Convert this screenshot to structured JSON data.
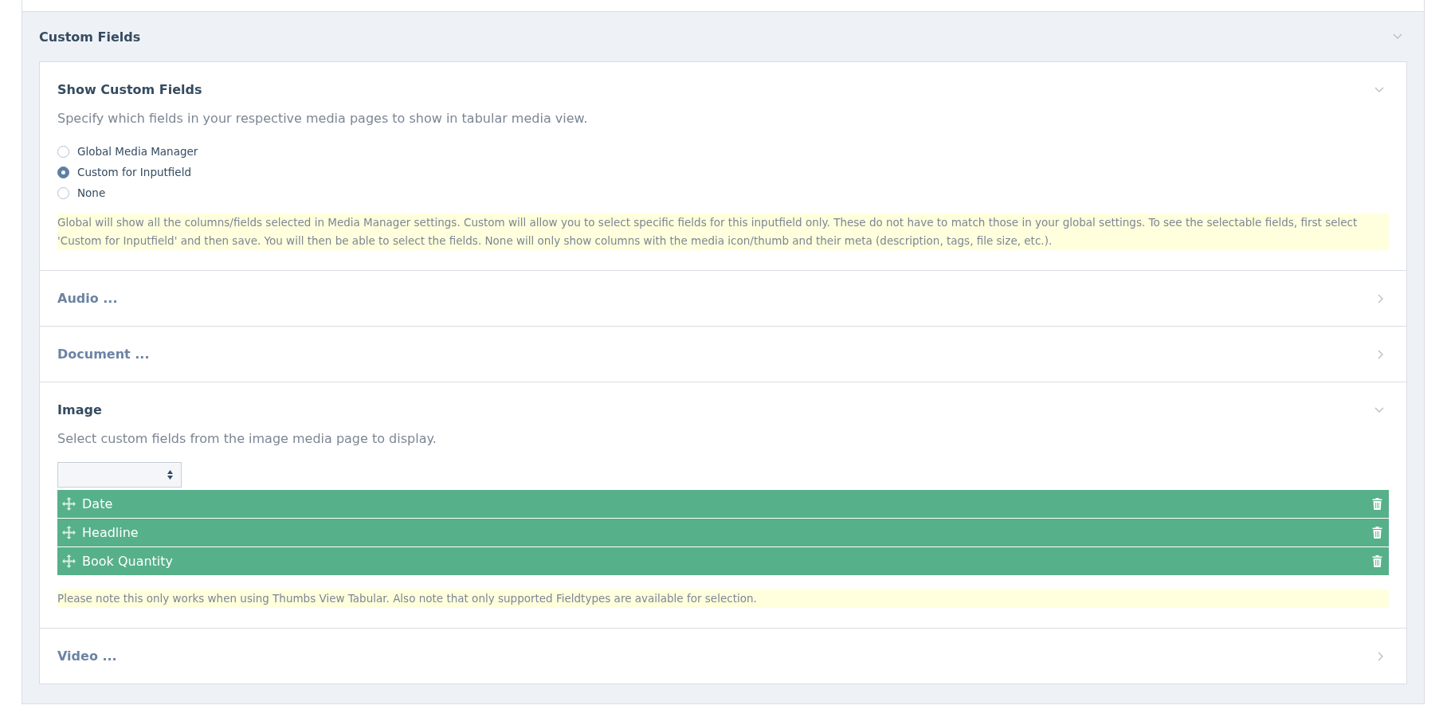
{
  "panel": {
    "title": "Custom Fields",
    "expanded": true
  },
  "sections": [
    {
      "kind": "radios",
      "title": "Show Custom Fields",
      "expanded": true,
      "description": "Specify which fields in your respective media pages to show in tabular media view.",
      "options": [
        {
          "label": "Global Media Manager",
          "selected": false
        },
        {
          "label": "Custom for Inputfield",
          "selected": true
        },
        {
          "label": "None",
          "selected": false
        }
      ],
      "note": "Global will show all the columns/fields selected in Media Manager settings. Custom will allow you to select specific fields for this inputfield only. These do not have to match those in your global settings. To see the selectable fields, first select 'Custom for Inputfield' and then save. You will then be able to select the fields. None will only show columns with the media icon/thumb and their meta (description, tags, file size, etc.)."
    },
    {
      "title": "Audio ...",
      "expanded": false
    },
    {
      "title": "Document ...",
      "expanded": false
    },
    {
      "kind": "field-list",
      "title": "Image",
      "expanded": true,
      "description": "Select custom fields from the image media page to display.",
      "fields": [
        {
          "label": "Date"
        },
        {
          "label": "Headline"
        },
        {
          "label": "Book Quantity"
        }
      ],
      "note": "Please note this only works when using Thumbs View Tabular. Also note that only supported Fieldtypes are available for selection."
    },
    {
      "title": "Video ...",
      "expanded": false
    }
  ]
}
